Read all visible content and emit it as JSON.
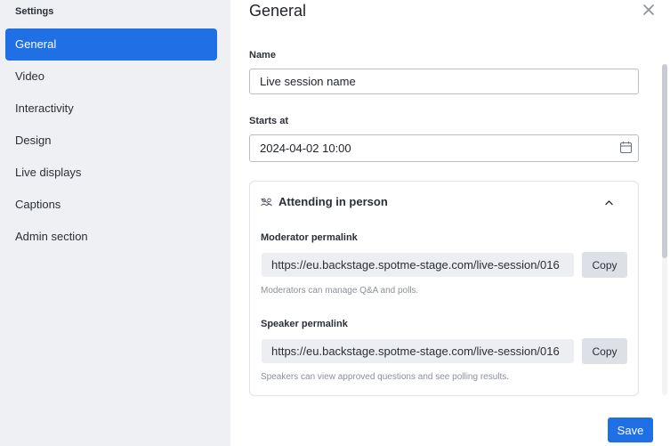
{
  "sidebar": {
    "title": "Settings",
    "items": [
      {
        "label": "General"
      },
      {
        "label": "Video"
      },
      {
        "label": "Interactivity"
      },
      {
        "label": "Design"
      },
      {
        "label": "Live displays"
      },
      {
        "label": "Captions"
      },
      {
        "label": "Admin section"
      }
    ],
    "active_index": 0
  },
  "main": {
    "title": "General",
    "name_field": {
      "label": "Name",
      "value": "Live session name"
    },
    "starts_at_field": {
      "label": "Starts at",
      "value": "2024-04-02 10:00"
    },
    "attending_card": {
      "title": "Attending in person",
      "icon": "people-icon",
      "expanded": true,
      "moderator": {
        "label": "Moderator permalink",
        "url": "https://eu.backstage.spotme-stage.com/live-session/016",
        "copy_label": "Copy",
        "help": "Moderators can manage Q&A and polls."
      },
      "speaker": {
        "label": "Speaker permalink",
        "url": "https://eu.backstage.spotme-stage.com/live-session/016",
        "copy_label": "Copy",
        "help": "Speakers can view approved questions and see polling results."
      }
    },
    "save_label": "Save"
  },
  "colors": {
    "accent": "#1f6fe5",
    "sidebar_bg": "#eef0f3"
  }
}
